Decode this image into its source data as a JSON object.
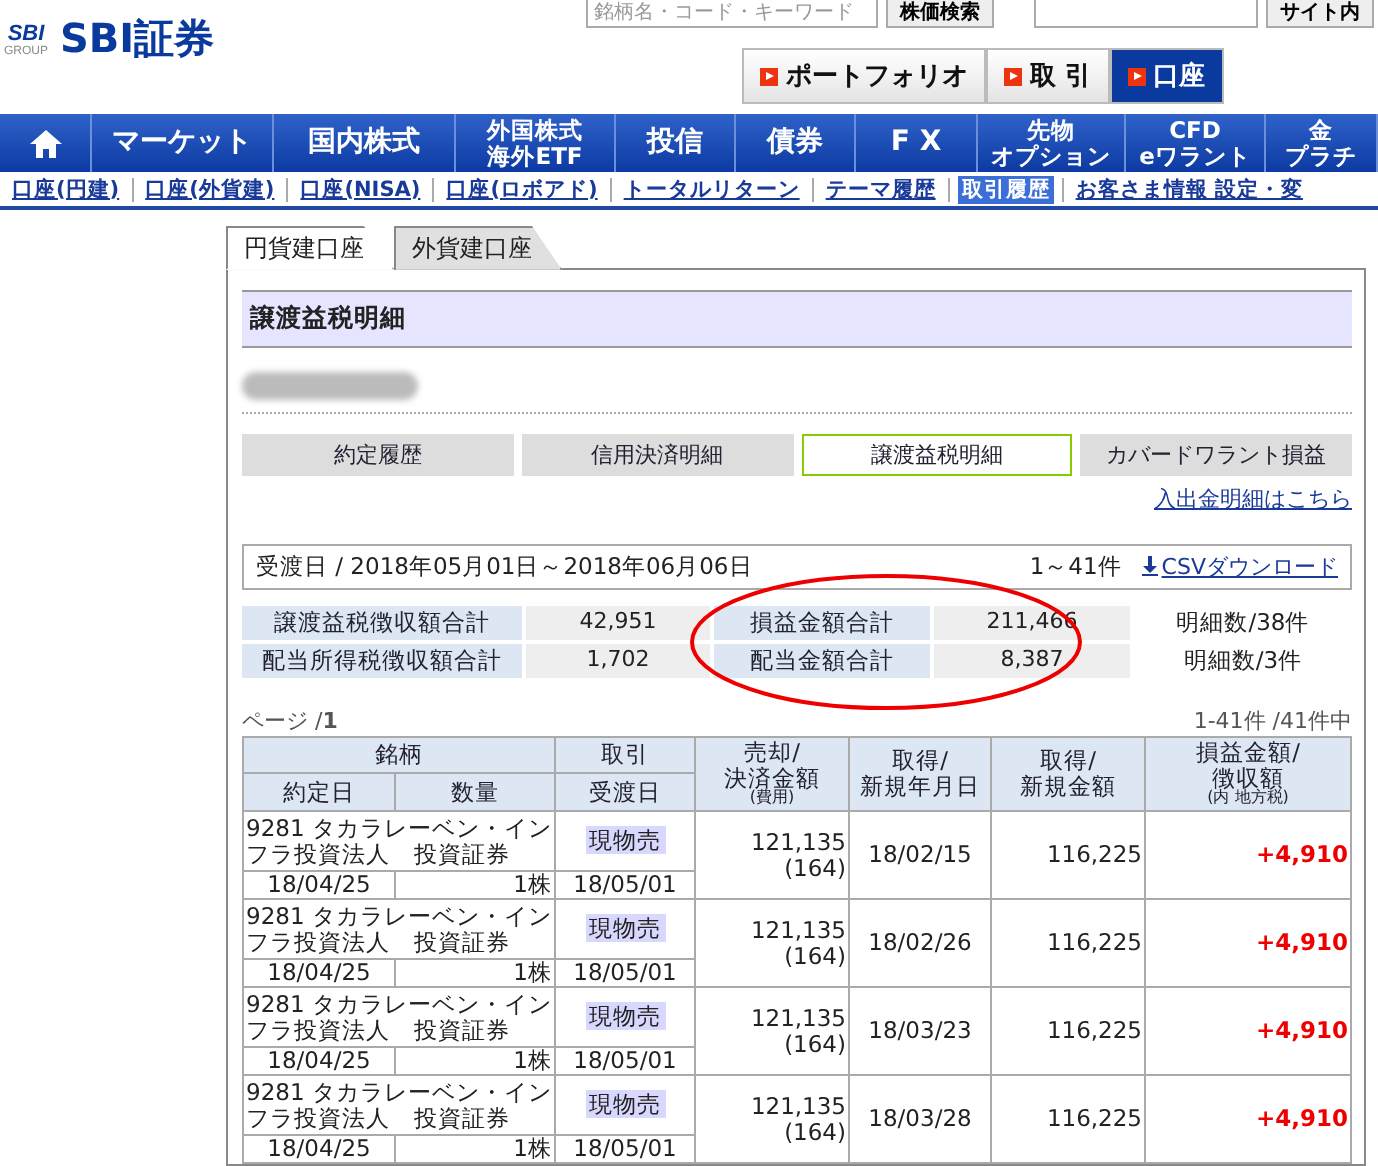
{
  "header": {
    "logo_group": "SBI",
    "logo_group_sub": "GROUP",
    "logo_text": "SBI証券",
    "search_placeholder": "銘柄名・コード・キーワード",
    "search_button": "株価検索",
    "site_search_button": "サイト内",
    "quick_buttons": [
      {
        "label": "ポートフォリオ",
        "selected": false
      },
      {
        "label": "取 引",
        "selected": false
      },
      {
        "label": "口座",
        "selected": true
      }
    ]
  },
  "nav": [
    {
      "kind": "home"
    },
    {
      "kind": "text",
      "label": "マーケット"
    },
    {
      "kind": "text",
      "label": "国内株式"
    },
    {
      "kind": "small",
      "lines": [
        "外国株式",
        "海外ETF"
      ]
    },
    {
      "kind": "text",
      "label": "投信"
    },
    {
      "kind": "text",
      "label": "債券"
    },
    {
      "kind": "text",
      "label": "F X"
    },
    {
      "kind": "small",
      "lines": [
        "先物",
        "オプション"
      ]
    },
    {
      "kind": "small",
      "lines": [
        "CFD",
        "eワラント"
      ]
    },
    {
      "kind": "small",
      "lines": [
        "金",
        "プラチ"
      ]
    }
  ],
  "subnav": [
    {
      "label": "口座(円建)",
      "selected": false
    },
    {
      "label": "口座(外貨建)",
      "selected": false
    },
    {
      "label": "口座(NISA)",
      "selected": false
    },
    {
      "label": "口座(ロボアド)",
      "selected": false
    },
    {
      "label": "トータルリターン",
      "selected": false
    },
    {
      "label": "テーマ履歴",
      "selected": false
    },
    {
      "label": "取引履歴",
      "selected": true
    },
    {
      "label": "お客さま情報 設定・変",
      "selected": false
    }
  ],
  "account_tabs": [
    {
      "label": "円貨建口座",
      "selected": true
    },
    {
      "label": "外貨建口座",
      "selected": false
    }
  ],
  "section_title": "譲渡益税明細",
  "report_tabs": [
    {
      "label": "約定履歴",
      "selected": false
    },
    {
      "label": "信用決済明細",
      "selected": false
    },
    {
      "label": "譲渡益税明細",
      "selected": true
    },
    {
      "label": "カバードワラント損益",
      "selected": false
    }
  ],
  "cash_link": "入出金明細はこちら",
  "period": {
    "label": "受渡日 / 2018年05月01日～2018年06月06日",
    "count": "1～41件",
    "csv_link": "CSVダウンロード"
  },
  "summary": [
    {
      "label1": "譲渡益税徴収額合計",
      "value1": "42,951",
      "label2": "損益金額合計",
      "value2": "211,466",
      "note": "明細数/38件"
    },
    {
      "label1": "配当所得税徴収額合計",
      "value1": "1,702",
      "label2": "配当金額合計",
      "value2": "8,387",
      "note": "明細数/3件"
    }
  ],
  "page_label": "ページ /",
  "page_number": "1",
  "range": "1-41件 /41件中",
  "table": {
    "columns": {
      "name": "銘柄",
      "trade": "取引",
      "sell": "売却/\n決済金額",
      "sell_sub": "(費用)",
      "acq_date": "取得/\n新規年月日",
      "acq_amount": "取得/\n新規金額",
      "profit": "損益金額/\n徴収額",
      "profit_sub": "(内 地方税)",
      "contract_date": "約定日",
      "quantity": "数量",
      "delivery_date": "受渡日"
    },
    "rows": [
      {
        "name": "9281 タカラレーベン・インフラ投資法人　投資証券",
        "contract_date": "18/04/25",
        "quantity": "1株",
        "trade": "現物売",
        "delivery_date": "18/05/01",
        "sell": "121,135",
        "fee": "(164)",
        "acq_date": "18/02/15",
        "acq_amount": "116,225",
        "profit": "+4,910"
      },
      {
        "name": "9281 タカラレーベン・インフラ投資法人　投資証券",
        "contract_date": "18/04/25",
        "quantity": "1株",
        "trade": "現物売",
        "delivery_date": "18/05/01",
        "sell": "121,135",
        "fee": "(164)",
        "acq_date": "18/02/26",
        "acq_amount": "116,225",
        "profit": "+4,910"
      },
      {
        "name": "9281 タカラレーベン・インフラ投資法人　投資証券",
        "contract_date": "18/04/25",
        "quantity": "1株",
        "trade": "現物売",
        "delivery_date": "18/05/01",
        "sell": "121,135",
        "fee": "(164)",
        "acq_date": "18/03/23",
        "acq_amount": "116,225",
        "profit": "+4,910"
      },
      {
        "name": "9281 タカラレーベン・インフラ投資法人　投資証券",
        "contract_date": "18/04/25",
        "quantity": "1株",
        "trade": "現物売",
        "delivery_date": "18/05/01",
        "sell": "121,135",
        "fee": "(164)",
        "acq_date": "18/03/28",
        "acq_amount": "116,225",
        "profit": "+4,910"
      }
    ]
  }
}
